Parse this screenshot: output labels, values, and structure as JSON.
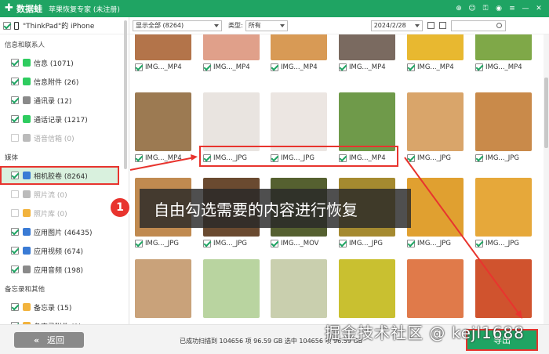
{
  "titlebar": {
    "brand": "数据蛙",
    "subtitle": "苹果恢复专家 (未注册)",
    "brand_color": "#1fa463"
  },
  "device": {
    "name": "\"ThinkPad\"的 iPhone"
  },
  "sidebar": {
    "section_contacts": "信息和联系人",
    "contacts_items": [
      {
        "label": "信息 (1071)",
        "checked": true,
        "dim": false,
        "icon": "message-icon",
        "color": "#2ecc5f"
      },
      {
        "label": "信息附件 (26)",
        "checked": true,
        "dim": false,
        "icon": "attachment-icon",
        "color": "#2ecc5f"
      },
      {
        "label": "通讯录 (12)",
        "checked": true,
        "dim": false,
        "icon": "contacts-icon",
        "color": "#8a8a8a"
      },
      {
        "label": "通话记录 (1217)",
        "checked": true,
        "dim": false,
        "icon": "phone-icon",
        "color": "#2ecc5f"
      },
      {
        "label": "语音信箱 (0)",
        "checked": false,
        "dim": true,
        "icon": "voicemail-icon",
        "color": "#bbbbbb"
      }
    ],
    "section_media": "媒体",
    "media_items": [
      {
        "label": "相机胶卷 (8264)",
        "checked": true,
        "dim": false,
        "active": true,
        "icon": "camera-roll-icon",
        "color": "#3a7bd5"
      },
      {
        "label": "照片流 (0)",
        "checked": false,
        "dim": true,
        "icon": "photo-stream-icon",
        "color": "#bbbbbb"
      },
      {
        "label": "照片库 (0)",
        "checked": false,
        "dim": true,
        "icon": "photo-library-icon",
        "color": "#f2b33d"
      },
      {
        "label": "应用图片 (46435)",
        "checked": true,
        "dim": false,
        "icon": "app-photos-icon",
        "color": "#3a7bd5"
      },
      {
        "label": "应用视频 (674)",
        "checked": true,
        "dim": false,
        "icon": "app-videos-icon",
        "color": "#3a7bd5"
      },
      {
        "label": "应用音频 (198)",
        "checked": true,
        "dim": false,
        "icon": "app-audio-icon",
        "color": "#8a8a8a"
      }
    ],
    "section_notes": "备忘录和其他",
    "notes_items": [
      {
        "label": "备忘录 (15)",
        "checked": true,
        "dim": false,
        "icon": "notes-icon",
        "color": "#f2b33d"
      },
      {
        "label": "备忘录附件 (3)",
        "checked": true,
        "dim": false,
        "icon": "notes-attachment-icon",
        "color": "#f2b33d"
      },
      {
        "label": "日历 (141)",
        "checked": true,
        "dim": false,
        "icon": "calendar-icon",
        "color": "#e8342e"
      }
    ]
  },
  "toolbar": {
    "filter_value": "显示全部 (8264)",
    "type_label": "类型:",
    "type_value": "所有",
    "date_value": "2024/2/28"
  },
  "grid": {
    "rows": [
      {
        "items": [
          {
            "name": "IMG..._MP4",
            "color": "#b3744a"
          },
          {
            "name": "IMG..._MP4",
            "color": "#e0a08a"
          },
          {
            "name": "IMG..._MP4",
            "color": "#d89a55"
          },
          {
            "name": "IMG..._MP4",
            "color": "#7a6a60"
          },
          {
            "name": "IMG..._MP4",
            "color": "#e8b830"
          },
          {
            "name": "IMG..._MP4",
            "color": "#7fa848"
          }
        ]
      },
      {
        "items": [
          {
            "name": "IMG..._MP4",
            "color": "#9c7a52"
          },
          {
            "name": "IMG..._JPG",
            "color": "#e9e4e0"
          },
          {
            "name": "IMG..._JPG",
            "color": "#ece6e2"
          },
          {
            "name": "IMG..._MP4",
            "color": "#6f9a4a"
          },
          {
            "name": "IMG..._JPG",
            "color": "#d9a56a"
          },
          {
            "name": "IMG..._JPG",
            "color": "#c98a4a"
          }
        ]
      },
      {
        "items": [
          {
            "name": "IMG..._JPG",
            "color": "#c08a50"
          },
          {
            "name": "IMG..._JPG",
            "color": "#6a4a30"
          },
          {
            "name": "IMG..._MOV",
            "color": "#556030"
          },
          {
            "name": "IMG..._JPG",
            "color": "#a58a30"
          },
          {
            "name": "IMG..._JPG",
            "color": "#e0a030"
          },
          {
            "name": "IMG..._JPG",
            "color": "#e6a83a"
          }
        ]
      },
      {
        "items": [
          {
            "name": "",
            "color": "#c9a27a"
          },
          {
            "name": "",
            "color": "#b9d4a0"
          },
          {
            "name": "",
            "color": "#c9cfae"
          },
          {
            "name": "",
            "color": "#c9c030"
          },
          {
            "name": "",
            "color": "#e07a4a"
          },
          {
            "name": "",
            "color": "#d0532e"
          }
        ]
      }
    ]
  },
  "callout": {
    "number": "1",
    "text": "自由勾选需要的内容进行恢复"
  },
  "footer": {
    "back_label": "返回",
    "status": "已成功扫描到 104656 项 96.59 GB  选中 104656 项 96.59 GB",
    "export_label": "导出",
    "watermark": "掘金技术社区 @ kejl1688"
  }
}
